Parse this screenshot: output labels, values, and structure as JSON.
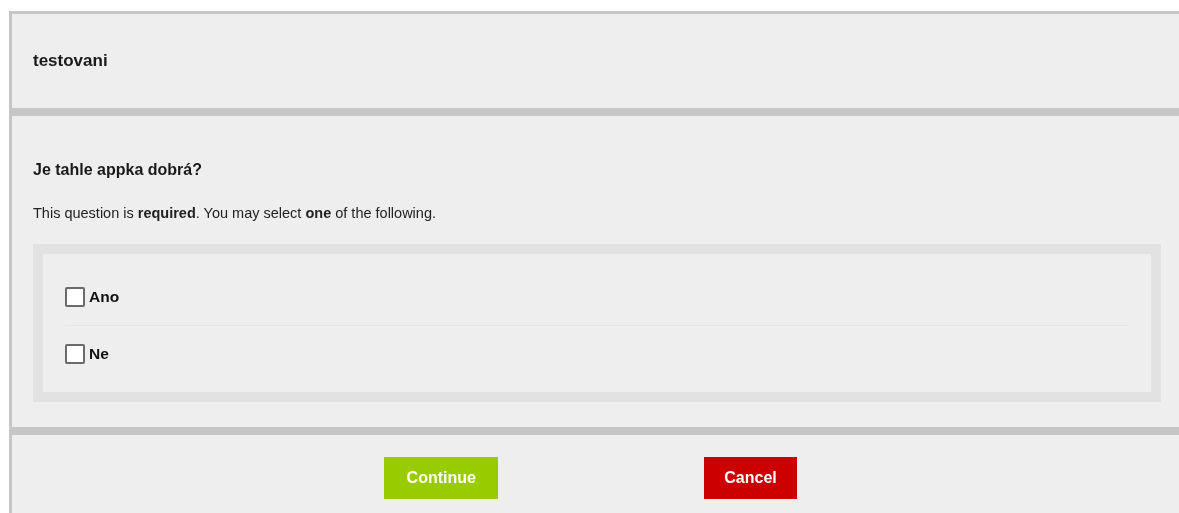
{
  "header": {
    "title": "testovani"
  },
  "question": {
    "title": "Je tahle appka dobrá?",
    "description": "This question is **required**. You may select **one** of the following."
  },
  "options": [
    {
      "label": "Ano",
      "checked": false
    },
    {
      "label": "Ne",
      "checked": false
    }
  ],
  "buttons": [
    {
      "label": "Continue",
      "kind": "primary"
    },
    {
      "label": "Cancel",
      "kind": "danger"
    }
  ]
}
